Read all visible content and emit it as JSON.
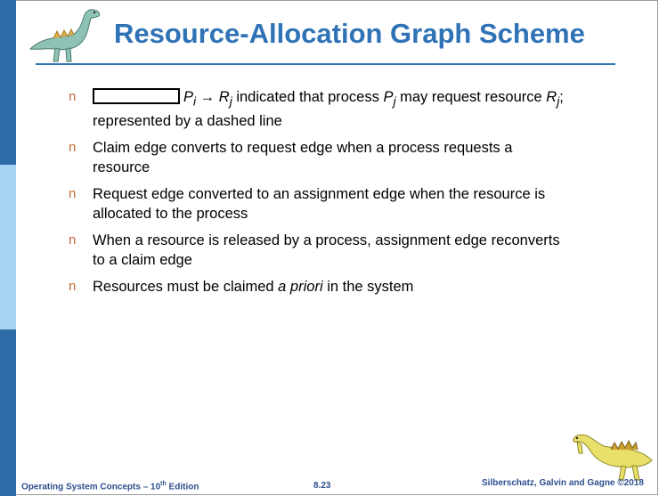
{
  "slide": {
    "title": "Resource-Allocation Graph Scheme",
    "bullet_marker": "n",
    "bullets": [
      {
        "pre": "",
        "p": "P",
        "p_sub": "i",
        "arrow": "→",
        "r": "R",
        "r_sub": "j",
        "mid": " indicated that process ",
        "p2": "P",
        "p2_sub": "j",
        "post": " may request resource ",
        "r2": "R",
        "r2_sub": "j",
        "tail": "; represented by a dashed line"
      },
      {
        "text": "Claim edge converts to request edge when a process requests a resource"
      },
      {
        "text": "Request edge converted to an assignment edge when the resource is allocated to the process"
      },
      {
        "text": "When a resource is released by a process, assignment edge reconverts to a claim edge"
      },
      {
        "pre": "Resources must be claimed ",
        "italic": "a priori",
        "post": " in the system"
      }
    ]
  },
  "footer": {
    "book": "Operating System Concepts – 10",
    "edition_sup": "th",
    "edition_word": " Edition",
    "page": "8.23",
    "copyright": "Silberschatz, Galvin and Gagne ©2018"
  },
  "colors": {
    "title": "#2f73b6",
    "sidebar_dark": "#2f6ba6",
    "sidebar_light": "#a9d3f2",
    "bullet_marker": "#c86a3c",
    "footer": "#2f4f8f"
  }
}
